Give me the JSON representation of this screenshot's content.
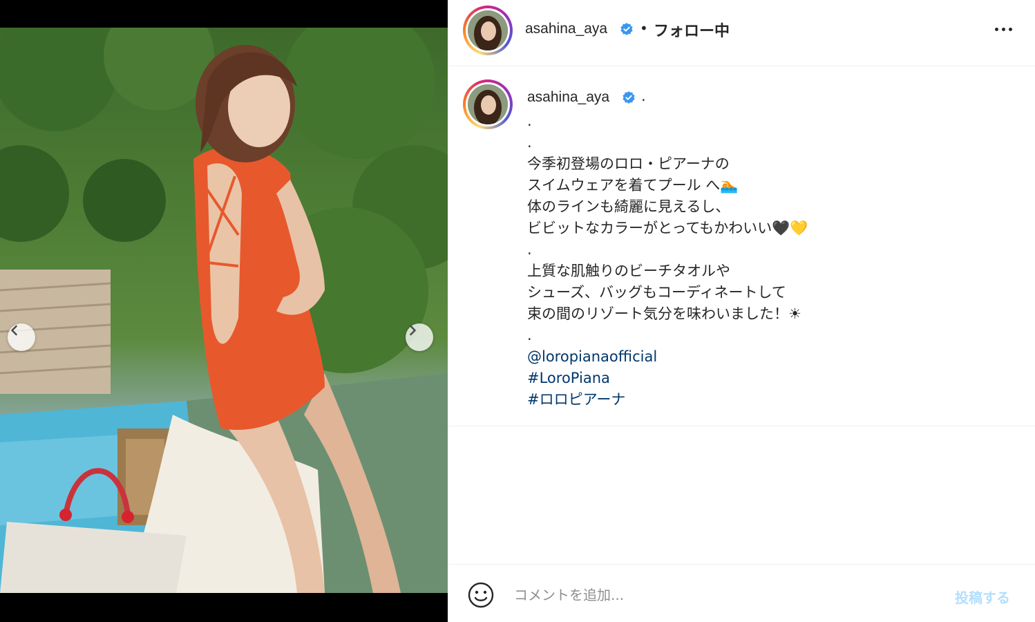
{
  "post": {
    "username": "asahina_aya",
    "separator": "•",
    "follow_status": "フォロー中",
    "more_icon": "more-horizontal-icon"
  },
  "caption": {
    "username": "asahina_aya",
    "first_line": ".",
    "lines": [
      ".",
      ".",
      "今季初登場のロロ・ピアーナの",
      "スイムウェアを着てプール へ🏊",
      "体のラインも綺麗に見えるし、",
      "ビビットなカラーがとってもかわいい🖤💛",
      ".",
      "上質な肌触りのビーチタオルや",
      "シューズ、バッグもコーディネートして",
      "束の間のリゾート気分を味わいました！☀",
      "."
    ],
    "mention": "@loropianaofficial",
    "hashtags": [
      "#LoroPiana",
      "#ロロピアーナ"
    ]
  },
  "carousel": {
    "dot_count": 5,
    "active_index": 0,
    "prev_icon": "chevron-left-icon",
    "next_icon": "chevron-right-icon"
  },
  "comment": {
    "placeholder": "コメントを追加...",
    "post_label": "投稿する",
    "emoji_icon": "smiley-icon"
  },
  "colors": {
    "link": "#00376b",
    "verified": "#3897f0",
    "post_button_disabled": "#b2dffc",
    "swimsuit": "#e8582d"
  }
}
